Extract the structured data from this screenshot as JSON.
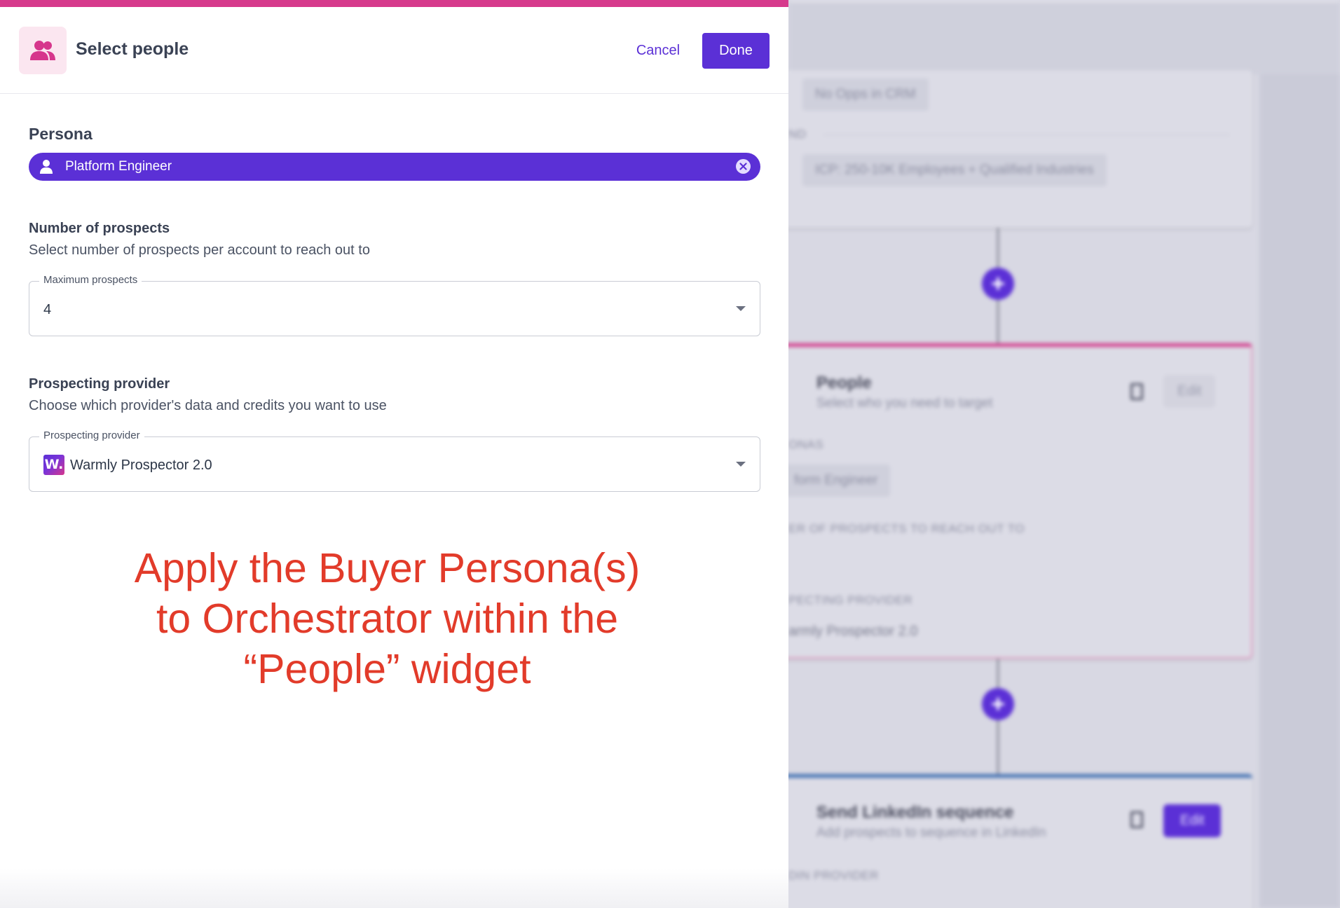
{
  "panel": {
    "title": "Select people",
    "header_icon": "people-icon",
    "cancel_label": "Cancel",
    "done_label": "Done",
    "accent_color": "#5b30d6",
    "top_bar_color": "#d63a8c"
  },
  "persona": {
    "label": "Persona",
    "selected": "Platform Engineer"
  },
  "prospects": {
    "heading": "Number of prospects",
    "description": "Select number of prospects per account to reach out to",
    "field_label": "Maximum prospects",
    "value": "4"
  },
  "provider": {
    "heading": "Prospecting provider",
    "description": "Choose which provider's data and credits you want to use",
    "field_label": "Prospecting provider",
    "value": "Warmly Prospector 2.0",
    "logo_text": "W."
  },
  "annotation": {
    "line1": "Apply the Buyer Persona(s)",
    "line2": "to Orchestrator within the",
    "line3": "“People” widget",
    "color": "#e23b2a"
  },
  "background": {
    "card_a": {
      "pill1": "No Opps in CRM",
      "connector": "ND",
      "pill2": "ICP: 250-10K Employees + Qualified Industries"
    },
    "card_b": {
      "title": "People",
      "subtitle": "Select who you need to target",
      "edit_label": "Edit",
      "personas_label": "ONAS",
      "persona_value": "form Engineer",
      "number_label": "ER OF PROSPECTS TO REACH OUT TO",
      "provider_label": "PECTING PROVIDER",
      "provider_value": "armly Prospector 2.0"
    },
    "card_c": {
      "title": "Send LinkedIn sequence",
      "subtitle": "Add prospects to sequence in LinkedIn",
      "edit_label": "Edit",
      "provider_label": "DIN PROVIDER"
    }
  }
}
